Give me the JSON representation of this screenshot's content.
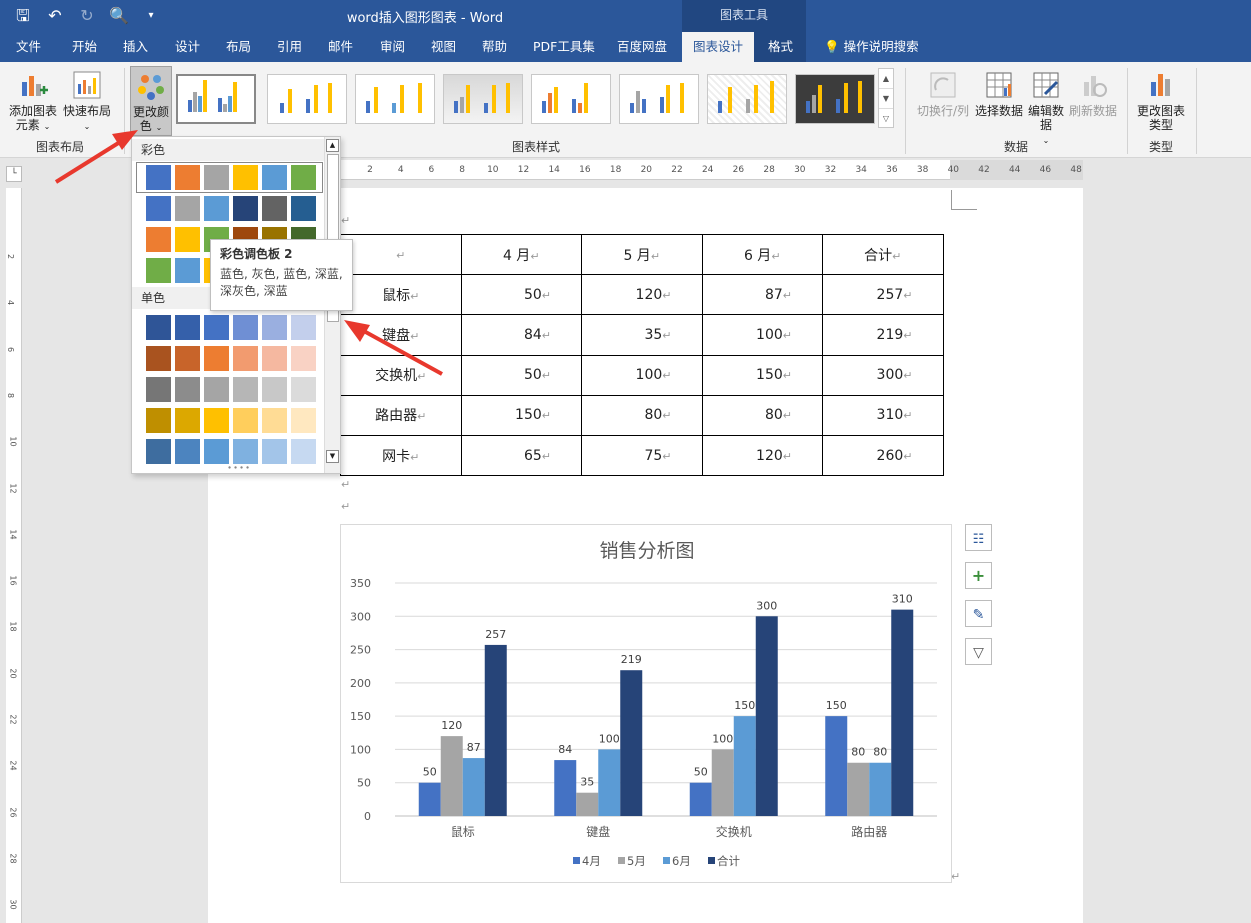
{
  "window": {
    "title": "word插入图形图表  -  Word",
    "context_tab_group": "图表工具"
  },
  "qat": {
    "save": "save-icon",
    "undo": "undo-icon",
    "redo": "redo-icon",
    "print_preview": "print-preview-icon",
    "customize": "customize-qat-icon"
  },
  "tabs": [
    "文件",
    "开始",
    "插入",
    "设计",
    "布局",
    "引用",
    "邮件",
    "审阅",
    "视图",
    "帮助",
    "PDF工具集",
    "百度网盘",
    "图表设计",
    "格式",
    "操作说明搜索"
  ],
  "active_tab": "图表设计",
  "ribbon": {
    "add_chart_element": "添加图表元素",
    "quick_layout": "快速布局",
    "change_colors": "更改颜色",
    "group_chart_layouts": "图表布局",
    "group_chart_styles": "图表样式",
    "switch_row_col": "切换行/列",
    "select_data": "选择数据",
    "edit_data": "编辑数据",
    "refresh_data": "刷新数据",
    "group_data": "数据",
    "change_chart_type": "更改图表类型",
    "group_type": "类型"
  },
  "color_dropdown": {
    "section_colorful": "彩色",
    "section_mono": "单色",
    "colorful_rows": [
      [
        "#4472c4",
        "#ed7d31",
        "#a5a5a5",
        "#ffc000",
        "#5b9bd5",
        "#70ad47"
      ],
      [
        "#4472c4",
        "#a5a5a5",
        "#5b9bd5",
        "#264478",
        "#636363",
        "#255e91"
      ],
      [
        "#ed7d31",
        "#ffc000",
        "#70ad47",
        "#9e480e",
        "#997300",
        "#43682b"
      ],
      [
        "#70ad47",
        "#5b9bd5",
        "#ffc000",
        "#43682b",
        "#255e91",
        "#997300"
      ]
    ],
    "mono_rows": [
      [
        "#2f5597",
        "#3560aa",
        "#4472c4",
        "#6f8fd4",
        "#9aafe0",
        "#c3cfec"
      ],
      [
        "#a9531f",
        "#c8642a",
        "#ed7d31",
        "#f29b6f",
        "#f5b8a0",
        "#f9d2c4"
      ],
      [
        "#767676",
        "#8c8c8c",
        "#a5a5a5",
        "#b6b6b6",
        "#c8c8c8",
        "#dbdbdb"
      ],
      [
        "#bf8f00",
        "#dca800",
        "#ffc000",
        "#ffce5c",
        "#ffdc95",
        "#ffe8c0"
      ],
      [
        "#3e6d9f",
        "#4c84bf",
        "#5b9bd5",
        "#7fb1e0",
        "#a3c5e9",
        "#c6d9f1"
      ]
    ]
  },
  "tooltip": {
    "title": "彩色调色板 2",
    "body": "蓝色, 灰色, 蓝色, 深蓝, 深灰色, 深蓝"
  },
  "ruler": {
    "h_marks": [
      "2",
      "4",
      "6",
      "8",
      "10",
      "12",
      "14",
      "16",
      "18",
      "20",
      "22",
      "24",
      "26",
      "28",
      "30",
      "32",
      "34",
      "36",
      "38",
      "40",
      "42",
      "44",
      "46",
      "48"
    ],
    "v_marks": [
      "2",
      "4",
      "6",
      "8",
      "10",
      "12",
      "14",
      "16",
      "18",
      "20",
      "22",
      "24",
      "26",
      "28",
      "30"
    ]
  },
  "table": {
    "header": [
      "",
      "4 月",
      "5 月",
      "6 月",
      "合计"
    ],
    "rows": [
      [
        "鼠标",
        "50",
        "120",
        "87",
        "257"
      ],
      [
        "键盘",
        "84",
        "35",
        "100",
        "219"
      ],
      [
        "交换机",
        "50",
        "100",
        "150",
        "300"
      ],
      [
        "路由器",
        "150",
        "80",
        "80",
        "310"
      ],
      [
        "网卡",
        "65",
        "75",
        "120",
        "260"
      ]
    ]
  },
  "chart_data": {
    "type": "bar",
    "title": "销售分析图",
    "categories": [
      "鼠标",
      "键盘",
      "交换机",
      "路由器"
    ],
    "series": [
      {
        "name": "4月",
        "values": [
          50,
          84,
          50,
          150
        ],
        "color": "#4472c4"
      },
      {
        "name": "5月",
        "values": [
          120,
          35,
          100,
          80
        ],
        "color": "#a5a5a5"
      },
      {
        "name": "6月",
        "values": [
          87,
          100,
          150,
          80
        ],
        "color": "#5b9bd5"
      },
      {
        "name": "合计",
        "values": [
          257,
          219,
          300,
          310
        ],
        "color": "#264478"
      }
    ],
    "ylim": [
      0,
      350
    ],
    "yticks": [
      0,
      50,
      100,
      150,
      200,
      250,
      300,
      350
    ],
    "grid": true,
    "legend": "bottom",
    "data_labels": true
  },
  "chart_side_buttons": [
    "layout-options-icon",
    "chart-elements-plus-icon",
    "chart-styles-brush-icon",
    "chart-filters-icon"
  ]
}
